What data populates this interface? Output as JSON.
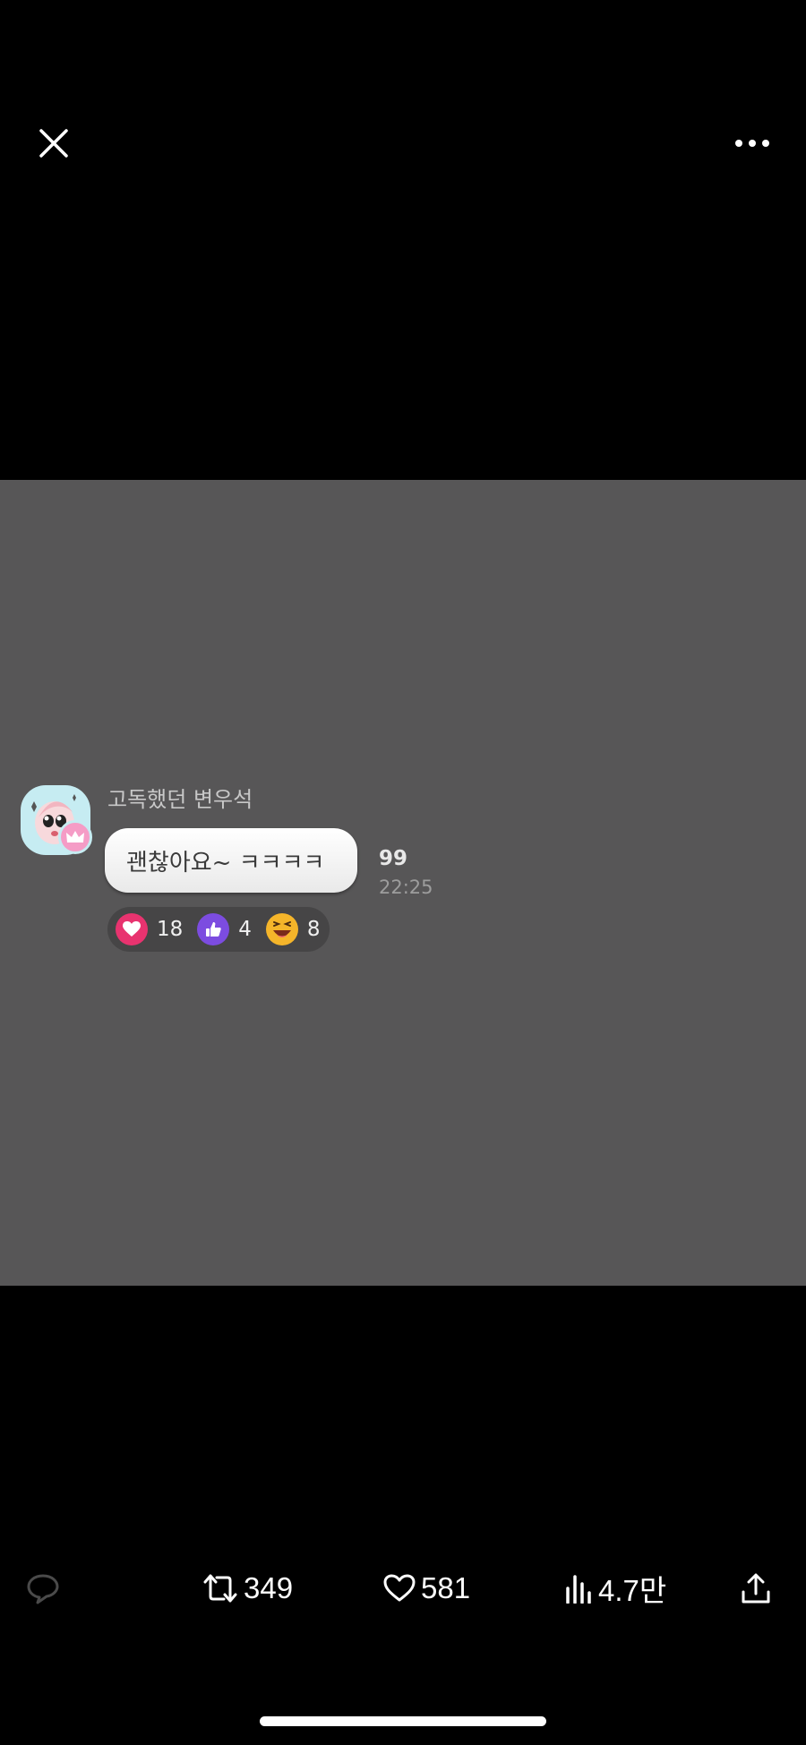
{
  "topbar": {
    "close_icon": "close-icon",
    "more_icon": "more-horizontal-icon"
  },
  "message": {
    "sender_name": "고독했던 변우석",
    "text": "괜찮아요~ ㅋㅋㅋㅋ",
    "unread_count": "99",
    "time": "22:25",
    "reactions": [
      {
        "icon": "heart-reaction-icon",
        "color": "#e8336f",
        "count": "18"
      },
      {
        "icon": "thumbs-up-reaction-icon",
        "color": "#7c4ce0",
        "count": "4"
      },
      {
        "icon": "laughing-face-reaction-icon",
        "color": "#f5b52a",
        "count": "8"
      }
    ]
  },
  "actions": {
    "reply_icon": "comment-icon",
    "repost_count": "349",
    "like_count": "581",
    "views_count": "4.7만",
    "share_icon": "share-icon"
  },
  "colors": {
    "background": "#000000",
    "media_background": "#575657",
    "icon_muted": "#4a4a4a"
  }
}
